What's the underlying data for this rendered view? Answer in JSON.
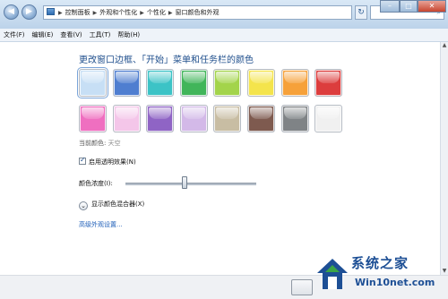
{
  "window": {
    "nav": {
      "back_glyph": "◀",
      "forward_glyph": "▶"
    },
    "breadcrumb": [
      "控制面板",
      "外观和个性化",
      "个性化",
      "窗口颜色和外观"
    ],
    "breadcrumb_icon": "control-panel-icon",
    "search_placeholder": "",
    "controls": {
      "minimize": "–",
      "maximize": "□",
      "close": "✕"
    }
  },
  "menubar": {
    "items": [
      "文件(F)",
      "编辑(E)",
      "查看(V)",
      "工具(T)",
      "帮助(H)"
    ]
  },
  "content": {
    "heading": "更改窗口边框、「开始」菜单和任务栏的颜色",
    "swatches": [
      {
        "name": "sky",
        "color": "#c7dff5",
        "selected": true
      },
      {
        "name": "twilight",
        "color": "#4f7ed0"
      },
      {
        "name": "sea",
        "color": "#3cc3c6"
      },
      {
        "name": "leaf",
        "color": "#41b55a"
      },
      {
        "name": "lime",
        "color": "#a3d44b"
      },
      {
        "name": "lemon",
        "color": "#f4e44c"
      },
      {
        "name": "pumpkin",
        "color": "#f6a13a"
      },
      {
        "name": "ruby",
        "color": "#dc3d3d"
      },
      {
        "name": "fuchsia",
        "color": "#ef6fc0"
      },
      {
        "name": "blush",
        "color": "#f4c6e9"
      },
      {
        "name": "violet",
        "color": "#8f64c5"
      },
      {
        "name": "lavender",
        "color": "#d3b9e8"
      },
      {
        "name": "taupe",
        "color": "#c8bda3"
      },
      {
        "name": "chocolate",
        "color": "#7e5a4f"
      },
      {
        "name": "slate",
        "color": "#7f8386"
      },
      {
        "name": "frost",
        "color": "#f0f0f0"
      }
    ],
    "current_color_label": "当前颜色:",
    "current_color_value": "天空",
    "transparency": {
      "label": "启用透明效果(N)",
      "checked": true
    },
    "intensity": {
      "label": "颜色浓度(I):",
      "value_fraction": 0.45
    },
    "mixer": {
      "label": "显示颜色混合器(X)",
      "icon": "chevron-down-icon"
    },
    "advanced_link": "高级外观设置..."
  },
  "watermark": {
    "title": "系统之家",
    "url": "Win10net.com",
    "colors": {
      "primary": "#1d4f95",
      "accent": "#3aa547"
    }
  }
}
